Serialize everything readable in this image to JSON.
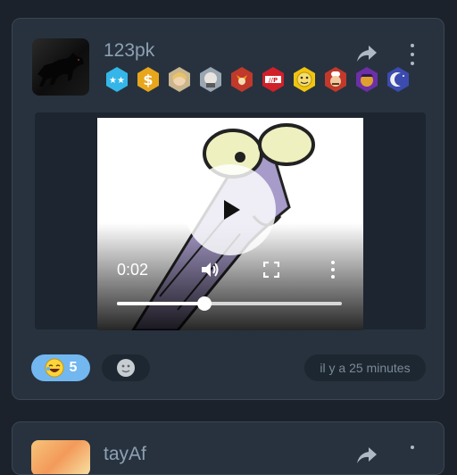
{
  "post": {
    "username": "123pk",
    "badges": [
      "stars-badge-icon",
      "dollar-badge-icon",
      "blonde-face-badge-icon",
      "bald-face-badge-icon",
      "fox-badge-icon",
      "mp-badge-icon",
      "smiley-badge-icon",
      "chef-badge-icon",
      "purple-face-badge-icon",
      "moon-badge-icon"
    ],
    "video": {
      "current_time": "0:02",
      "progress": 0.39
    },
    "reactions": [
      {
        "icon": "laughing-emoji-icon",
        "count": "5",
        "active": true
      },
      {
        "icon": "add-reaction-icon",
        "count": "",
        "active": false
      }
    ],
    "timestamp": "il y a 25 minutes"
  },
  "next_post": {
    "username": "tayAf"
  },
  "colors": {
    "background": "#1b222b",
    "card": "#27323e",
    "accent": "#72b7f0",
    "username": "#8ea0b3"
  }
}
